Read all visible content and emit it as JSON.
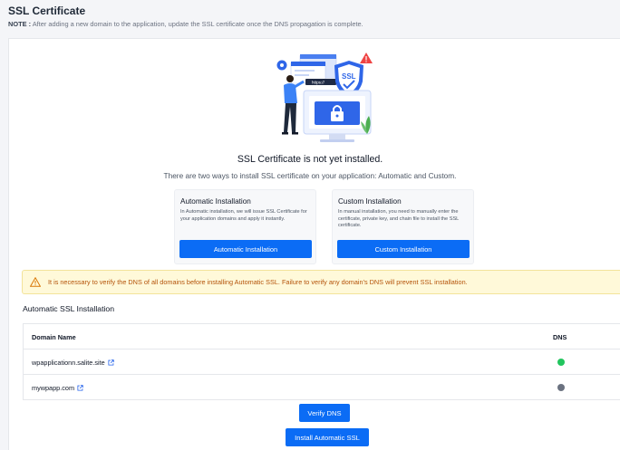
{
  "header": {
    "title": "SSL Certificate",
    "note_label": "NOTE :",
    "note_text": "After adding a new domain to the application, update the SSL certificate once the DNS propagation is complete."
  },
  "illustration": {
    "url_text": "https://",
    "badge_text": "SSL"
  },
  "status": {
    "heading": "SSL Certificate is not yet installed.",
    "subheading": "There are two ways to install SSL certificate on your application: Automatic and Custom."
  },
  "options": {
    "automatic": {
      "title": "Automatic Installation",
      "description": "In Automatic installation, we will issue SSL Certificate for your application domains and apply it instantly.",
      "button_label": "Automatic Installation"
    },
    "custom": {
      "title": "Custom Installation",
      "description": "In manual installation, you need to manually enter the certificate, private key, and chain file to install the SSL certificate.",
      "button_label": "Custom Installation"
    }
  },
  "warning": {
    "text": "It is necessary to verify the DNS of all domains before installing Automatic SSL. Failure to verify any domain's DNS will prevent SSL installation."
  },
  "auto_ssl": {
    "section_title": "Automatic SSL Installation",
    "columns": [
      "Domain Name",
      "DNS"
    ],
    "rows": [
      {
        "domain": "wpapplicationn.salite.site",
        "dns_status_color": "#22c55e"
      },
      {
        "domain": "mywpapp.com",
        "dns_status_color": "#6b7280"
      }
    ],
    "verify_button": "Verify DNS",
    "install_button": "Install Automatic SSL"
  },
  "colors": {
    "primary": "#0b6cf5",
    "warning_bg": "#fff9d9",
    "warning_text": "#b45309",
    "dns_ok": "#22c55e",
    "dns_pending": "#6b7280"
  }
}
